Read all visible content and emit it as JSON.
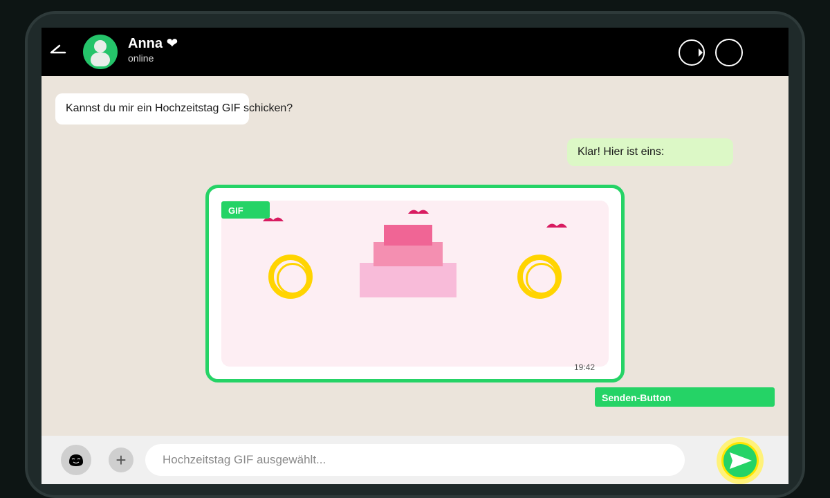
{
  "contact": {
    "name": "Anna ❤",
    "status": "online"
  },
  "messages": {
    "incoming_text": "Kannst du mir ein Hochzeitstag GIF schicken?",
    "outgoing_text": "Klar! Hier ist eins:"
  },
  "gif": {
    "badge": "GIF",
    "time": "19:42"
  },
  "send_label": "Senden-Button",
  "input": {
    "placeholder": "Hochzeitstag GIF ausgewählt..."
  },
  "icons": {
    "back": "back-arrow-icon",
    "video": "video-call-icon",
    "voice": "voice-call-icon",
    "emoji": "emoji-icon",
    "attach": "plus-icon",
    "send": "send-icon"
  },
  "colors": {
    "header": "#000000",
    "chat_background": "#ebe4db",
    "accent": "#25d366",
    "outgoing_bubble": "#dcf8c6",
    "send_highlight": "#ffe600",
    "ring_gold": "#ffd400",
    "heart": "#d81b60"
  }
}
